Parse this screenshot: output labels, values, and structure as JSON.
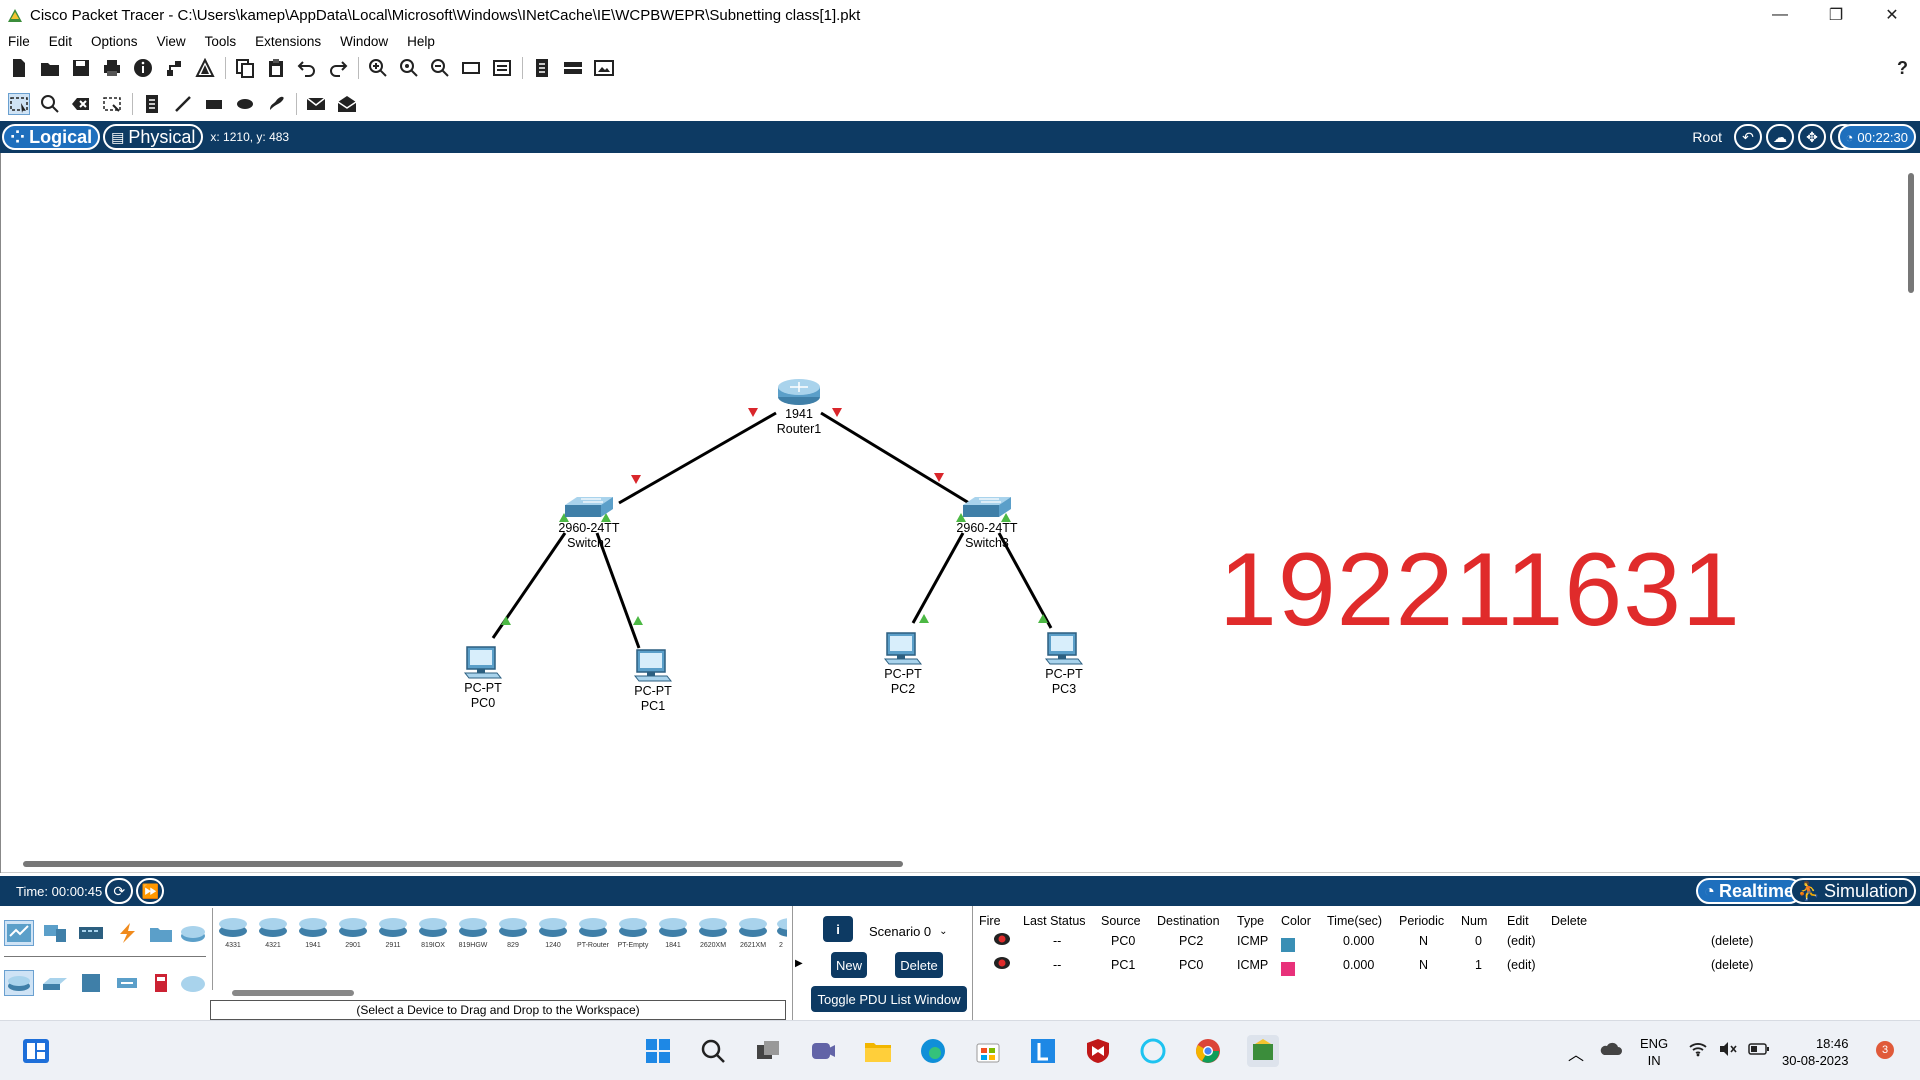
{
  "window": {
    "title": "Cisco Packet Tracer - C:\\Users\\kamep\\AppData\\Local\\Microsoft\\Windows\\INetCache\\IE\\WCPBWEPR\\Subnetting class[1].pkt",
    "minimize": "—",
    "restore": "❐",
    "close": "✕"
  },
  "menu": [
    "File",
    "Edit",
    "Options",
    "View",
    "Tools",
    "Extensions",
    "Window",
    "Help"
  ],
  "toolbar": {
    "help": "?"
  },
  "modebar": {
    "logical": "Logical",
    "physical": "Physical",
    "coords": "x: 1210, y: 483",
    "root": "Root",
    "clock": "00:22:30"
  },
  "topology": {
    "devices": [
      {
        "id": "router1",
        "model": "1941",
        "name": "Router1"
      },
      {
        "id": "switch2",
        "model": "2960-24TT",
        "name": "Switch2"
      },
      {
        "id": "switch3",
        "model": "2960-24TT",
        "name": "Switch3"
      },
      {
        "id": "pc0",
        "model": "PC-PT",
        "name": "PC0"
      },
      {
        "id": "pc1",
        "model": "PC-PT",
        "name": "PC1"
      },
      {
        "id": "pc2",
        "model": "PC-PT",
        "name": "PC2"
      },
      {
        "id": "pc3",
        "model": "PC-PT",
        "name": "PC3"
      }
    ],
    "link_colors": {
      "down": "#d9262b",
      "up": "#4cb844"
    },
    "watermark": "192211631"
  },
  "timebar": {
    "time": "Time: 00:00:45",
    "realtime": "Realtime",
    "simulation": "Simulation"
  },
  "device_panel": {
    "models": [
      "4331",
      "4321",
      "1941",
      "2901",
      "2911",
      "819IOX",
      "819HGW",
      "829",
      "1240",
      "PT-Router",
      "PT-Empty",
      "1841",
      "2620XM",
      "2621XM",
      "2"
    ],
    "hint": "(Select a Device to Drag and Drop to the Workspace)"
  },
  "scenario": {
    "info": "i",
    "selected": "Scenario 0",
    "new": "New",
    "delete": "Delete",
    "toggle": "Toggle PDU List Window"
  },
  "pdu": {
    "headers": [
      "Fire",
      "Last Status",
      "Source",
      "Destination",
      "Type",
      "Color",
      "Time(sec)",
      "Periodic",
      "Num",
      "Edit",
      "Delete"
    ],
    "rows": [
      {
        "status": "--",
        "source": "PC0",
        "destination": "PC2",
        "type": "ICMP",
        "color": "#3a8fb5",
        "time": "0.000",
        "periodic": "N",
        "num": "0",
        "edit": "(edit)",
        "delete": "(delete)"
      },
      {
        "status": "--",
        "source": "PC1",
        "destination": "PC0",
        "type": "ICMP",
        "color": "#e8317a",
        "time": "0.000",
        "periodic": "N",
        "num": "1",
        "edit": "(edit)",
        "delete": "(delete)"
      }
    ]
  },
  "taskbar": {
    "lang1": "ENG",
    "lang2": "IN",
    "time": "18:46",
    "date": "30-08-2023",
    "notifications": "3"
  }
}
